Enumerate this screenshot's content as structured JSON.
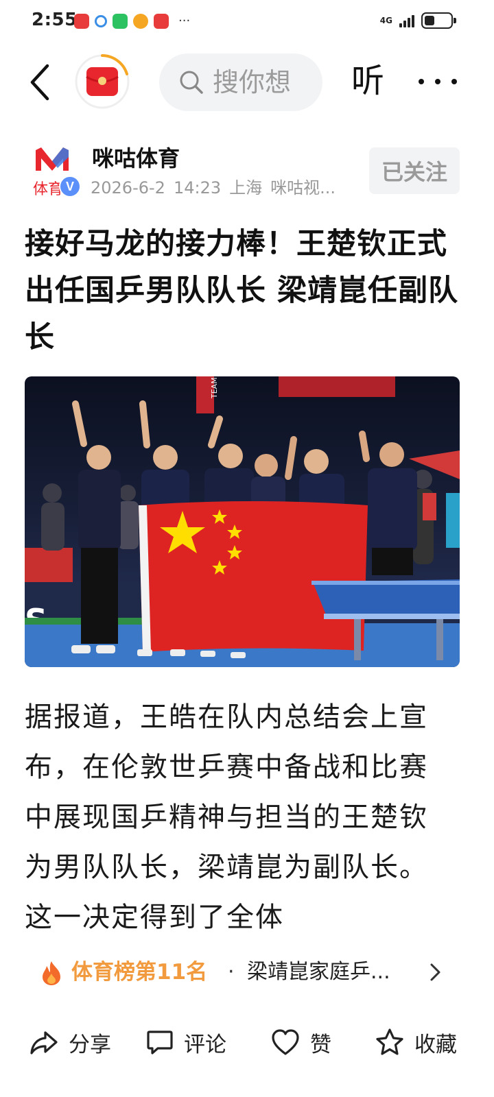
{
  "status_bar": {
    "time": "2:55",
    "network": "4G",
    "more": "···"
  },
  "topbar": {
    "search_placeholder": "搜你想",
    "listen_label": "听"
  },
  "author": {
    "logo_text": "体育",
    "name": "咪咕体育",
    "date": "2026-6-2",
    "time": "14:23",
    "location": "上海",
    "source": "咪咕视...",
    "follow_label": "已关注",
    "verified": true
  },
  "article": {
    "title": "接好马龙的接力棒！王楚钦正式出任国乒男队队长 梁靖崑任副队长",
    "photo_text": "TEAM",
    "body": "据报道，王皓在队内总结会上宣布，在伦敦世乒赛中备战和比赛中展现国乒精神与担当的王楚钦为男队队长，梁靖崑为副队长。这一决定得到了全体"
  },
  "trending": {
    "rank_label": "体育榜第11名",
    "separator": "·",
    "topic": "梁靖崑家庭乒..."
  },
  "actions": {
    "share": "分享",
    "comment": "评论",
    "like": "赞",
    "favorite": "收藏"
  },
  "colors": {
    "brand_red": "#e60012",
    "trend_orange": "#f19a3e",
    "verify_blue": "#5b8ff9",
    "muted_gray": "#999999"
  }
}
